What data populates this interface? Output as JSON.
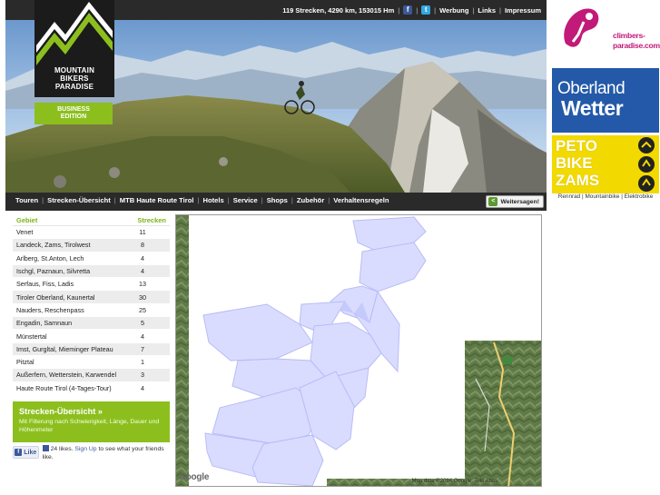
{
  "topbar": {
    "stats": "119 Strecken, 4290 km, 153015 Hm",
    "links": [
      "Werbung",
      "Links",
      "Impressum"
    ],
    "facebook_icon": "facebook-icon",
    "twitter_icon": "twitter-icon"
  },
  "logo": {
    "line1": "MOUNTAIN",
    "line2": "BIKERS",
    "line3": "PARADISE",
    "edition_line1": "BUSINESS",
    "edition_line2": "EDITION",
    "accent": "#8cbf1e"
  },
  "nav": {
    "items": [
      "Touren",
      "Strecken-Übersicht",
      "MTB Haute Route Tirol",
      "Hotels",
      "Service",
      "Shops",
      "Zubehör",
      "Verhaltensregeln"
    ],
    "share_label": "Weitersagen!",
    "share_icon": "share-icon"
  },
  "areas": {
    "col_area": "Gebiet",
    "col_count": "Strecken",
    "rows": [
      {
        "name": "Venet",
        "count": "11"
      },
      {
        "name": "Landeck, Zams, Tirolwest",
        "count": "8"
      },
      {
        "name": "Arlberg, St.Anton, Lech",
        "count": "4"
      },
      {
        "name": "Ischgl, Paznaun, Silvretta",
        "count": "4"
      },
      {
        "name": "Serfaus, Fiss, Ladis",
        "count": "13"
      },
      {
        "name": "Tiroler Oberland, Kaunertal",
        "count": "30"
      },
      {
        "name": "Nauders, Reschenpass",
        "count": "25"
      },
      {
        "name": "Engadin, Samnaun",
        "count": "5"
      },
      {
        "name": "Münstertal",
        "count": "4"
      },
      {
        "name": "Imst, Gurgltal, Mieminger Plateau",
        "count": "7"
      },
      {
        "name": "Pitztal",
        "count": "1"
      },
      {
        "name": "Außerfern, Wetterstein, Karwendel",
        "count": "3"
      },
      {
        "name": "Haute Route Tirol (4-Tages-Tour)",
        "count": "4"
      }
    ]
  },
  "uebersicht": {
    "title": "Strecken-Übersicht »",
    "desc": "Mit Filterung nach Schwierigkeit, Länge, Dauer und Höhenmeter"
  },
  "facebook": {
    "button": "Like",
    "likes": "24 likes.",
    "signup": "Sign Up",
    "rest": "to see what your friends like."
  },
  "map": {
    "logo": "Google",
    "attribution": "Map data ©2014 Google, Tele Atlas"
  },
  "ads": {
    "climbers": "climbers-paradise.com",
    "oberland_1": "Oberland",
    "oberland_2": "Wetter",
    "peto": [
      "PETO",
      "BIKE",
      "ZAMS"
    ],
    "peto_sub": "Rennrad | Mountainbike | Elektrobike"
  }
}
